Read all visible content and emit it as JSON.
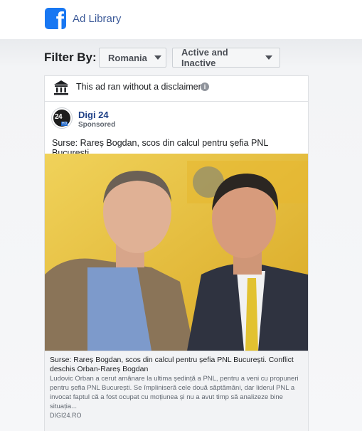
{
  "header": {
    "app_title": "Ad Library",
    "logo_letter": "f",
    "brand_color": "#1877f2"
  },
  "filters": {
    "label": "Filter By:",
    "country": "Romania",
    "status": "Active and Inactive"
  },
  "ad": {
    "disclaimer": "This ad ran without a disclaimer.",
    "advertiser": {
      "name": "Digi 24",
      "label": "Sponsored",
      "avatar_text": "24",
      "avatar_badge": "HD"
    },
    "body": "Surse: Rareș Bogdan, scos din calcul pentru șefia PNL București.",
    "link": {
      "title": "Surse: Rareș Bogdan, scos din calcul pentru șefia PNL București. Conflict deschis Orban-Rareș Bogdan",
      "description": "Ludovic Orban a cerut amânare la ultima ședință a PNL, pentru a veni cu propuneri pentru șefia PNL București. Se împliniseră cele două săptămâni, dar liderul PNL a invocat faptul că a fost ocupat cu moțiunea și nu a avut timp să analizeze bine situația...",
      "domain": "DIGI24.RO"
    }
  }
}
